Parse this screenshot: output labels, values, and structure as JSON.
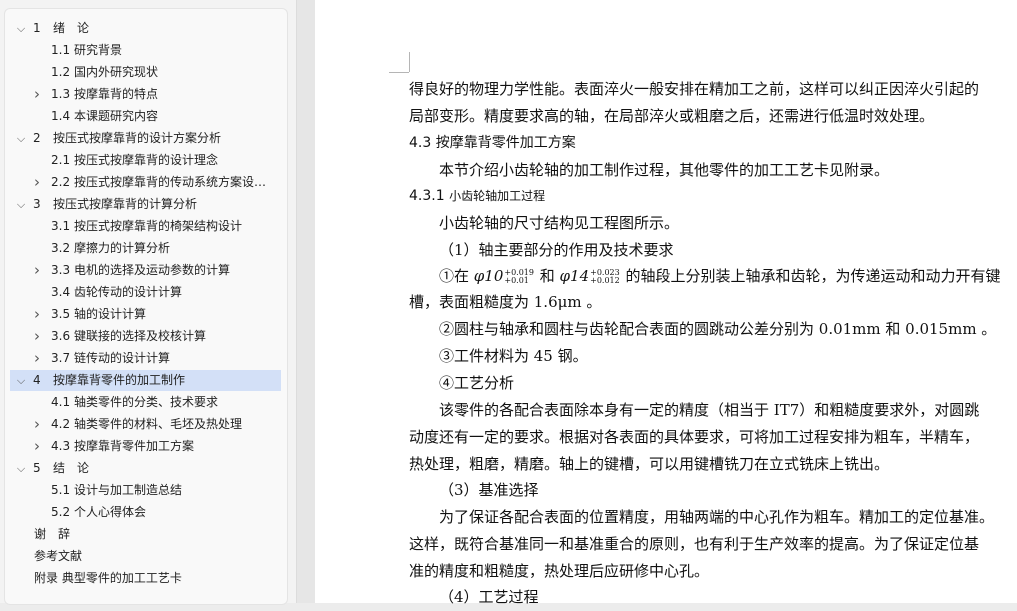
{
  "nav": {
    "items": [
      {
        "level": 1,
        "num": "1",
        "title": "绪　论",
        "expand": "down"
      },
      {
        "level": 2,
        "num": "1.1",
        "title": "研究背景",
        "expand": ""
      },
      {
        "level": 2,
        "num": "1.2",
        "title": "国内外研究现状",
        "expand": ""
      },
      {
        "level": 2,
        "num": "1.3",
        "title": "按摩靠背的特点",
        "expand": "right"
      },
      {
        "level": 2,
        "num": "1.4",
        "title": "本课题研究内容",
        "expand": ""
      },
      {
        "level": 1,
        "num": "2",
        "title": "按压式按摩靠背的设计方案分析",
        "expand": "down"
      },
      {
        "level": 2,
        "num": "2.1",
        "title": "按压式按摩靠背的设计理念",
        "expand": ""
      },
      {
        "level": 2,
        "num": "2.2",
        "title": "按压式按摩靠背的传动系统方案设…",
        "expand": "right"
      },
      {
        "level": 1,
        "num": "3",
        "title": "按压式按摩靠背的计算分析",
        "expand": "down"
      },
      {
        "level": 2,
        "num": "3.1",
        "title": "按压式按摩靠背的椅架结构设计",
        "expand": ""
      },
      {
        "level": 2,
        "num": "3.2",
        "title": "摩擦力的计算分析",
        "expand": ""
      },
      {
        "level": 2,
        "num": "3.3",
        "title": "电机的选择及运动参数的计算",
        "expand": "right"
      },
      {
        "level": 2,
        "num": "3.4",
        "title": "齿轮传动的设计计算",
        "expand": ""
      },
      {
        "level": 2,
        "num": "3.5",
        "title": "轴的设计计算",
        "expand": "right"
      },
      {
        "level": 2,
        "num": "3.6",
        "title": "键联接的选择及校核计算",
        "expand": "right"
      },
      {
        "level": 2,
        "num": "3.7",
        "title": "链传动的设计计算",
        "expand": "right"
      },
      {
        "level": 1,
        "num": "4",
        "title": "按摩靠背零件的加工制作",
        "expand": "down",
        "selected": true
      },
      {
        "level": 2,
        "num": "4.1",
        "title": "轴类零件的分类、技术要求",
        "expand": ""
      },
      {
        "level": 2,
        "num": "4.2",
        "title": "轴类零件的材料、毛坯及热处理",
        "expand": "right"
      },
      {
        "level": 2,
        "num": "4.3",
        "title": "按摩靠背零件加工方案",
        "expand": "right"
      },
      {
        "level": 1,
        "num": "5",
        "title": "结　论",
        "expand": "down"
      },
      {
        "level": 2,
        "num": "5.1",
        "title": "设计与加工制造总结",
        "expand": ""
      },
      {
        "level": 2,
        "num": "5.2",
        "title": "个人心得体会",
        "expand": ""
      },
      {
        "level": 0,
        "num": "",
        "title": "谢　辞",
        "expand": ""
      },
      {
        "level": 0,
        "num": "",
        "title": "参考文献",
        "expand": ""
      },
      {
        "level": 0,
        "num": "",
        "title": "附录 典型零件的加工工艺卡",
        "expand": ""
      }
    ]
  },
  "doc": {
    "l1": "得良好的物理力学性能。表面淬火一般安排在精加工之前，这样可以纠正因淬火引起的",
    "l2": "局部变形。精度要求高的轴，在局部淬火或粗磨之后，还需进行低温时效处理。",
    "h43": "4.3  按摩靠背零件加工方案",
    "l3": "本节介绍小齿轮轴的加工制作过程，其他零件的加工工艺卡见附录。",
    "h431_num": "4.3.1 ",
    "h431_title": "小齿轮轴加工过程",
    "l4": "小齿轮轴的尺寸结构见工程图所示。",
    "l5": "（1）轴主要部分的作用及技术要求",
    "l6a": "①在 ",
    "phi10": "φ10",
    "sup10": "+0.019",
    "sub10": "+0.01",
    "l6b": " 和 ",
    "phi14": "φ14",
    "sup14": "+0.023",
    "sub14": "+0.012",
    "l6c": " 的轴段上分别装上轴承和齿轮，为传递运动和动力开有键",
    "l7": "槽，表面粗糙度为 1.6μm 。",
    "l8": "②圆柱与轴承和圆柱与齿轮配合表面的圆跳动公差分别为 0.01mm 和 0.015mm 。",
    "l9": "③工件材料为 45 钢。",
    "l10": "④工艺分析",
    "l11": "该零件的各配合表面除本身有一定的精度（相当于 IT7）和粗糙度要求外，对圆跳",
    "l12": "动度还有一定的要求。根据对各表面的具体要求，可将加工过程安排为粗车，半精车，",
    "l13": "热处理，粗磨，精磨。轴上的键槽，可以用键槽铣刀在立式铣床上铣出。",
    "l14": "（3）基准选择",
    "l15": "为了保证各配合表面的位置精度，用轴两端的中心孔作为粗车。精加工的定位基准。",
    "l16": "这样，既符合基准同一和基准重合的原则，也有利于生产效率的提高。为了保证定位基",
    "l17": "准的精度和粗糙度，热处理后应研修中心孔。",
    "l18": "（4）工艺过程"
  }
}
